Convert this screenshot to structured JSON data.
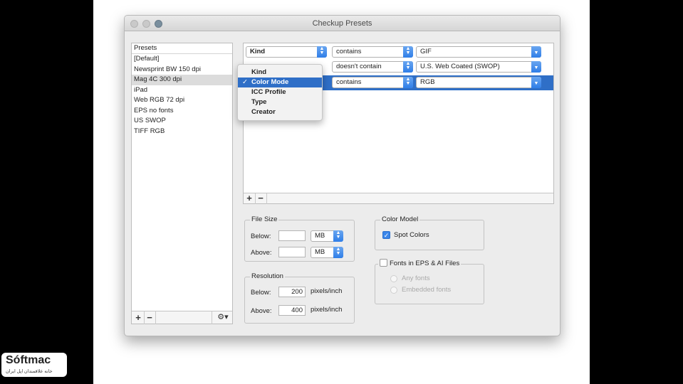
{
  "window": {
    "title": "Checkup Presets"
  },
  "presets": {
    "header": "Presets",
    "items": [
      "[Default]",
      "Newsprint BW 150 dpi",
      "Mag 4C 300 dpi",
      "iPad",
      "Web RGB 72 dpi",
      "EPS no fonts",
      "US SWOP",
      "TIFF RGB"
    ],
    "selected_index": 2,
    "add_label": "+",
    "remove_label": "−",
    "gear_label": "⚙▾"
  },
  "rules": [
    {
      "field": "Kind",
      "operator": "contains",
      "value": "GIF"
    },
    {
      "field": "",
      "operator": "doesn't contain",
      "value": "U.S. Web Coated (SWOP)"
    },
    {
      "field": "",
      "operator": "contains",
      "value": "RGB"
    }
  ],
  "rules_footer": {
    "add_label": "+",
    "remove_label": "−"
  },
  "field_menu": {
    "items": [
      "Kind",
      "Color Mode",
      "ICC Profile",
      "Type",
      "Creator"
    ],
    "selected": "Color Mode",
    "check": "✓"
  },
  "file_size": {
    "title": "File Size",
    "below_label": "Below:",
    "below_value": "",
    "below_unit": "MB",
    "above_label": "Above:",
    "above_value": "",
    "above_unit": "MB"
  },
  "resolution": {
    "title": "Resolution",
    "below_label": "Below:",
    "below_value": "200",
    "above_label": "Above:",
    "above_value": "400",
    "unit": "pixels/inch"
  },
  "color_model": {
    "title": "Color Model",
    "spot_colors_label": "Spot Colors",
    "spot_colors_checked": true
  },
  "fonts_eps": {
    "title": "Fonts in EPS & AI Files",
    "checked": false,
    "options": [
      "Any fonts",
      "Embedded fonts"
    ]
  },
  "watermark": {
    "logo": "Sóftmac",
    "tagline": "خانه علاقمندان اپل ایران"
  },
  "colors": {
    "selection": "#2f6fc7",
    "accent_blue": "#3a86ea"
  }
}
